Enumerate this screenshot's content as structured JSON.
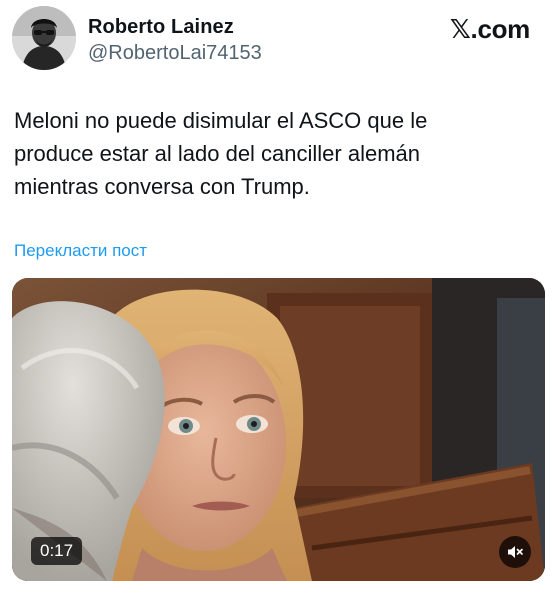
{
  "tweet": {
    "author": {
      "name": "Roberto Lainez",
      "handle": "@RobertoLai74153"
    },
    "brand": {
      "x_glyph": "𝕏",
      "suffix": ".com"
    },
    "text": "Meloni no puede disimular el ASCO que le\nproduce estar al lado del canciller alemán\nmientras conversa con Trump.",
    "translate_label": "Перекласти пост",
    "media": {
      "duration": "0:17",
      "icons": {
        "mute": "speaker-muted-icon"
      }
    }
  },
  "colors": {
    "text": "#0f1419",
    "secondary": "#536471",
    "link": "#1d9bf0"
  }
}
